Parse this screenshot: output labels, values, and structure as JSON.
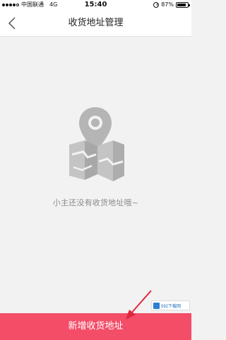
{
  "status_bar": {
    "carrier": "中国联通",
    "network": "4G",
    "time": "15:40",
    "battery_percent": "87%",
    "battery_level": 0.87,
    "signal_bars": 4
  },
  "nav": {
    "title": "收货地址管理",
    "back_icon": "chevron-left-icon"
  },
  "empty_state": {
    "message": "小主还没有收货地址哦~",
    "illustration_icon": "map-pin-icon"
  },
  "footer": {
    "add_button_label": "新增收货地址"
  },
  "watermark": {
    "text": "592下载网"
  },
  "colors": {
    "accent": "#f34d68",
    "background": "#f2f2f2",
    "illustration": "#b3b3b3",
    "annotation_arrow": "#e0263f"
  }
}
